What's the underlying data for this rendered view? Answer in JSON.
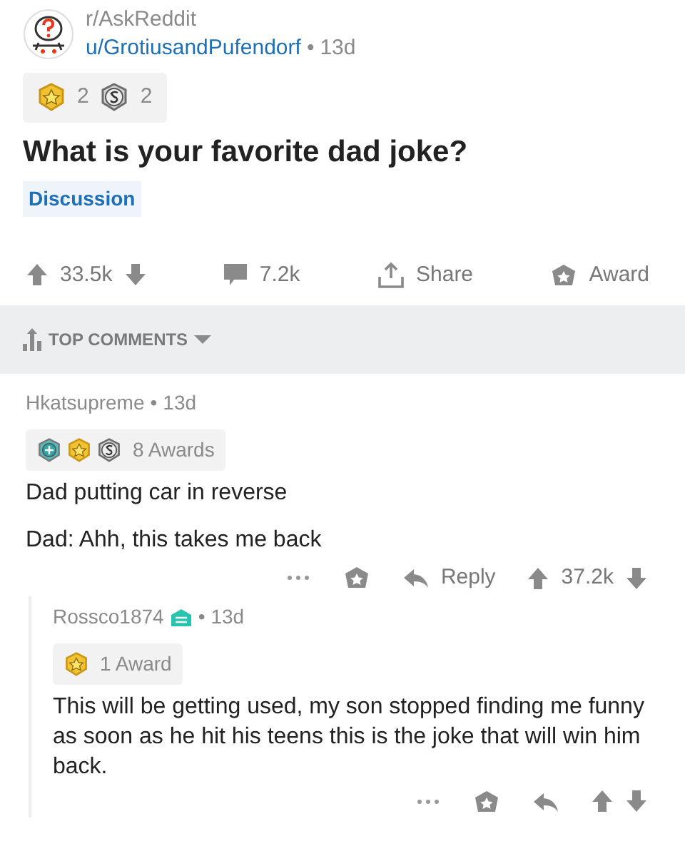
{
  "post": {
    "subreddit": "r/AskReddit",
    "author": "u/GrotiusandPufendorf",
    "separator": "•",
    "age": "13d",
    "awards": [
      {
        "kind": "gold",
        "count": "2"
      },
      {
        "kind": "silver",
        "count": "2"
      }
    ],
    "title": "What is your favorite dad joke?",
    "flair": "Discussion",
    "score": "33.5k",
    "comments": "7.2k",
    "share": "Share",
    "award": "Award"
  },
  "sort": {
    "label": "TOP COMMENTS"
  },
  "comments": [
    {
      "author": "Hkatsupreme",
      "separator": "•",
      "age": "13d",
      "awards": [
        {
          "kind": "platinum"
        },
        {
          "kind": "gold"
        },
        {
          "kind": "silver"
        }
      ],
      "award_count": "8 Awards",
      "paragraphs": [
        "Dad putting car in reverse",
        "Dad: Ahh, this takes me back"
      ],
      "reply": "Reply",
      "score": "37.2k",
      "children": [
        {
          "author": "Rossco1874",
          "moderator": true,
          "separator": "•",
          "age": "13d",
          "awards": [
            {
              "kind": "gold"
            }
          ],
          "award_count": "1 Award",
          "paragraphs": [
            "This will be getting used, my son stopped finding me funny as soon as he hit his teens this is the joke that will win him back."
          ]
        }
      ]
    }
  ]
}
